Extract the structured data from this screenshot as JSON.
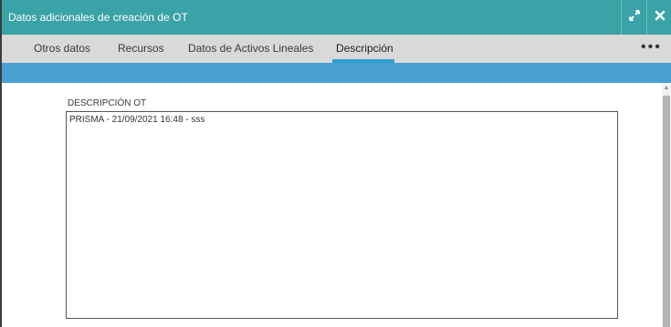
{
  "dialog": {
    "title": "Datos adicionales de creación de OT",
    "expand_icon": "expand-icon",
    "close_icon": "close-icon"
  },
  "tabs": [
    {
      "label": "Otros datos",
      "active": false
    },
    {
      "label": "Recursos",
      "active": false
    },
    {
      "label": "Datos de Activos Lineales",
      "active": false
    },
    {
      "label": "Descripción",
      "active": true
    }
  ],
  "more_icon": "more-horizontal-icon",
  "description": {
    "label": "DESCRIPCIÓN OT",
    "value": "PRISMA - 21/09/2021 16:48 - sss"
  },
  "colors": {
    "titlebar": "#3aa3a7",
    "tabbar": "#d9d9d9",
    "accent_bar": "#48a0d2",
    "active_tab_underline": "#2f9fcf"
  }
}
